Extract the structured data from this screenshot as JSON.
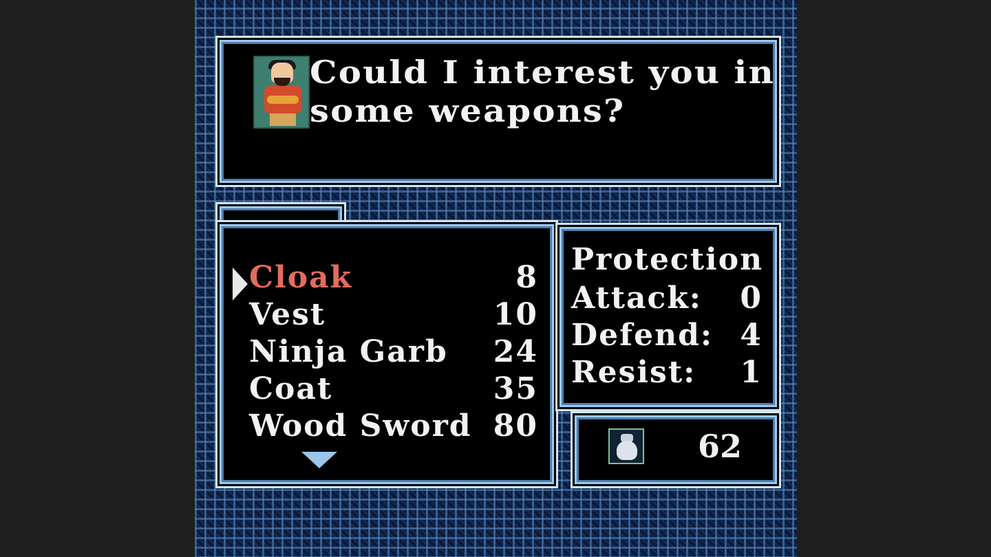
{
  "dialog": {
    "line1": "Could I interest you in",
    "line2": "some weapons?"
  },
  "shop": {
    "items": [
      {
        "name": "Cloak",
        "price": "8",
        "selected": true
      },
      {
        "name": "Vest",
        "price": "10"
      },
      {
        "name": "Ninja Garb",
        "price": "24"
      },
      {
        "name": "Coat",
        "price": "35"
      },
      {
        "name": "Wood Sword",
        "price": "80"
      }
    ]
  },
  "stats": {
    "title": "Protection",
    "attack_label": "Attack:",
    "attack_value": "0",
    "defend_label": "Defend:",
    "defend_value": "4",
    "resist_label": "Resist:",
    "resist_value": "1"
  },
  "gold": {
    "amount": "62",
    "icon": "money-bag-icon"
  },
  "colors": {
    "selected_item": "#e46b5f",
    "panel_border": "#9fc8ec",
    "text": "#f2f2f2"
  }
}
